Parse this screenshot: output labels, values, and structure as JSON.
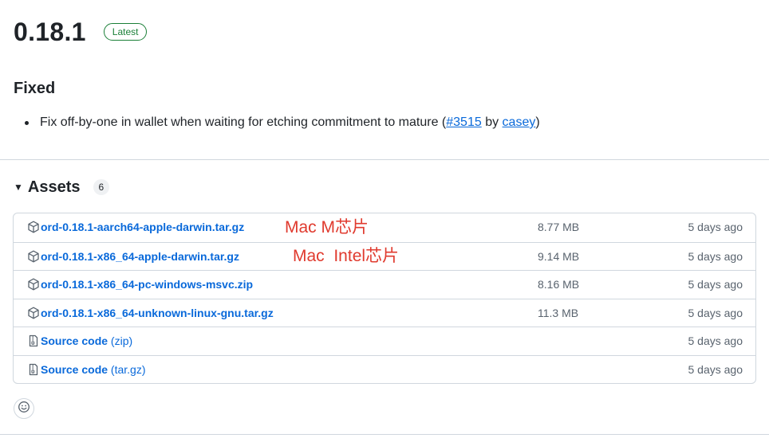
{
  "release": {
    "version": "0.18.1",
    "badge": "Latest"
  },
  "fixed": {
    "title": "Fixed",
    "note_text": "Fix off-by-one in wallet when waiting for etching commitment to mature (",
    "pr_link": "#3515",
    "by_text": " by ",
    "author_link": "casey",
    "close_paren": ")"
  },
  "assets": {
    "title": "Assets",
    "count": "6",
    "rows": [
      {
        "name": "ord-0.18.1-aarch64-apple-darwin.tar.gz",
        "ext": "",
        "size": "8.77 MB",
        "date": "5 days ago"
      },
      {
        "name": "ord-0.18.1-x86_64-apple-darwin.tar.gz",
        "ext": "",
        "size": "9.14 MB",
        "date": "5 days ago"
      },
      {
        "name": "ord-0.18.1-x86_64-pc-windows-msvc.zip",
        "ext": "",
        "size": "8.16 MB",
        "date": "5 days ago"
      },
      {
        "name": "ord-0.18.1-x86_64-unknown-linux-gnu.tar.gz",
        "ext": "",
        "size": "11.3 MB",
        "date": "5 days ago"
      },
      {
        "name": "Source code",
        "ext": " (zip)",
        "size": "",
        "date": "5 days ago"
      },
      {
        "name": "Source code",
        "ext": " (tar.gz)",
        "size": "",
        "date": "5 days ago"
      }
    ]
  },
  "annotations": {
    "mac_m": "Mac M芯片",
    "mac_intel": "Mac  Intel芯片"
  },
  "colors": {
    "link": "#0969da",
    "badge_green": "#1a7f37",
    "annotation_red": "#e03a2e",
    "border": "#d0d7de"
  }
}
